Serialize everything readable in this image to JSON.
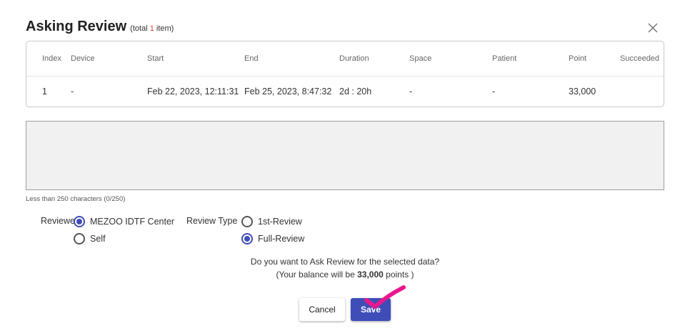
{
  "dialog": {
    "title": "Asking Review",
    "subtitle_prefix": "(total",
    "subtitle_count": "1",
    "subtitle_suffix": "item)"
  },
  "table": {
    "headers": {
      "index": "Index",
      "device": "Device",
      "start": "Start",
      "end": "End",
      "duration": "Duration",
      "space": "Space",
      "patient": "Patient",
      "point": "Point",
      "succeeded": "Succeeded"
    },
    "rows": [
      {
        "index": "1",
        "device": "-",
        "start": "Feb 22, 2023, 12:11:31",
        "end": "Feb 25, 2023, 8:47:32",
        "duration": "2d : 20h",
        "space": "-",
        "patient": "-",
        "point": "33,000",
        "succeeded": ""
      }
    ]
  },
  "comment": {
    "value": "",
    "char_hint": "Less than 250 characters (0/250)"
  },
  "reviewer": {
    "label": "Reviewer:",
    "options": [
      {
        "label": "MEZOO IDTF Center",
        "checked": true
      },
      {
        "label": "Self",
        "checked": false
      }
    ]
  },
  "review_type": {
    "label": "Review Type",
    "options": [
      {
        "label": "1st-Review",
        "checked": false
      },
      {
        "label": "Full-Review",
        "checked": true
      }
    ]
  },
  "confirm": {
    "question": "Do you want to Ask Review for the selected data?",
    "balance_prefix": "(Your balance will be",
    "balance_value": "33,000",
    "balance_suffix": "points )"
  },
  "buttons": {
    "cancel": "Cancel",
    "save": "Save"
  },
  "colors": {
    "accent": "#3f4db8",
    "count_highlight": "#e53935",
    "annotation_check": "#e8188c"
  },
  "icons": {
    "close": "close-icon",
    "annotation": "checkmark-icon"
  }
}
